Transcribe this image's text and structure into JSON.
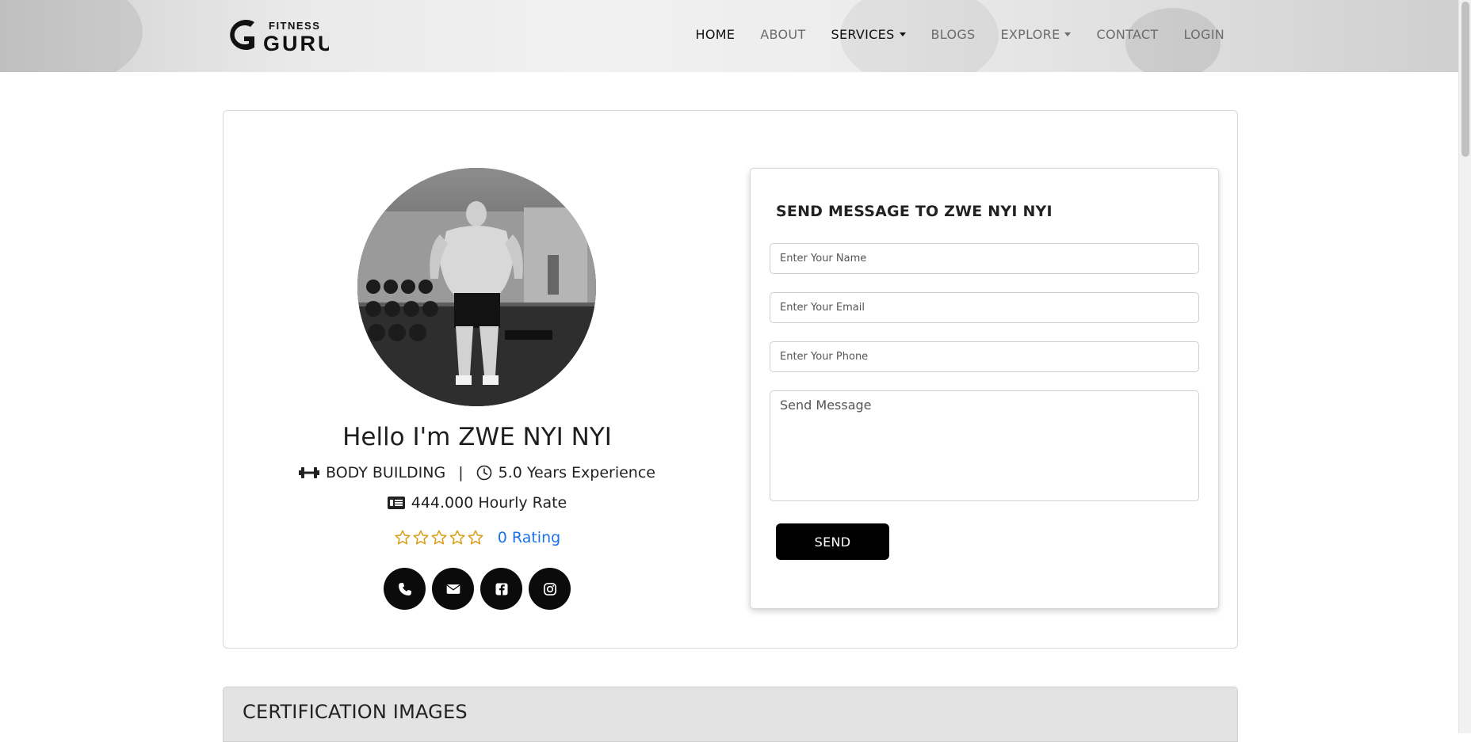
{
  "brand": {
    "logo_small": "FITNESS",
    "logo_main": "GURU"
  },
  "nav": {
    "items": [
      {
        "label": "HOME",
        "dropdown": false
      },
      {
        "label": "ABOUT",
        "dropdown": false
      },
      {
        "label": "SERVICES",
        "dropdown": true
      },
      {
        "label": "BLOGS",
        "dropdown": false
      },
      {
        "label": "EXPLORE",
        "dropdown": true
      },
      {
        "label": "CONTACT",
        "dropdown": false
      },
      {
        "label": "LOGIN",
        "dropdown": false
      }
    ]
  },
  "profile": {
    "greeting": "Hello I'm ZWE NYI NYI",
    "specialty": "BODY BUILDING",
    "separator": "|",
    "experience": "5.0 Years Experience",
    "rate": "444.000 Hourly Rate",
    "stars_filled": 0,
    "stars_total": 5,
    "rating_text": "0 Rating",
    "star_color": "#d89b12",
    "social_icons": [
      "phone-icon",
      "envelope-icon",
      "facebook-icon",
      "instagram-icon"
    ]
  },
  "contact_form": {
    "title": "SEND MESSAGE TO ZWE NYI NYI",
    "name_placeholder": "Enter Your Name",
    "email_placeholder": "Enter Your Email",
    "phone_placeholder": "Enter Your Phone",
    "message_placeholder": "Send Message",
    "send_label": "SEND"
  },
  "certification": {
    "title": "CERTIFICATION IMAGES"
  },
  "colors": {
    "accent": "#000000",
    "link": "#1a73e8"
  }
}
